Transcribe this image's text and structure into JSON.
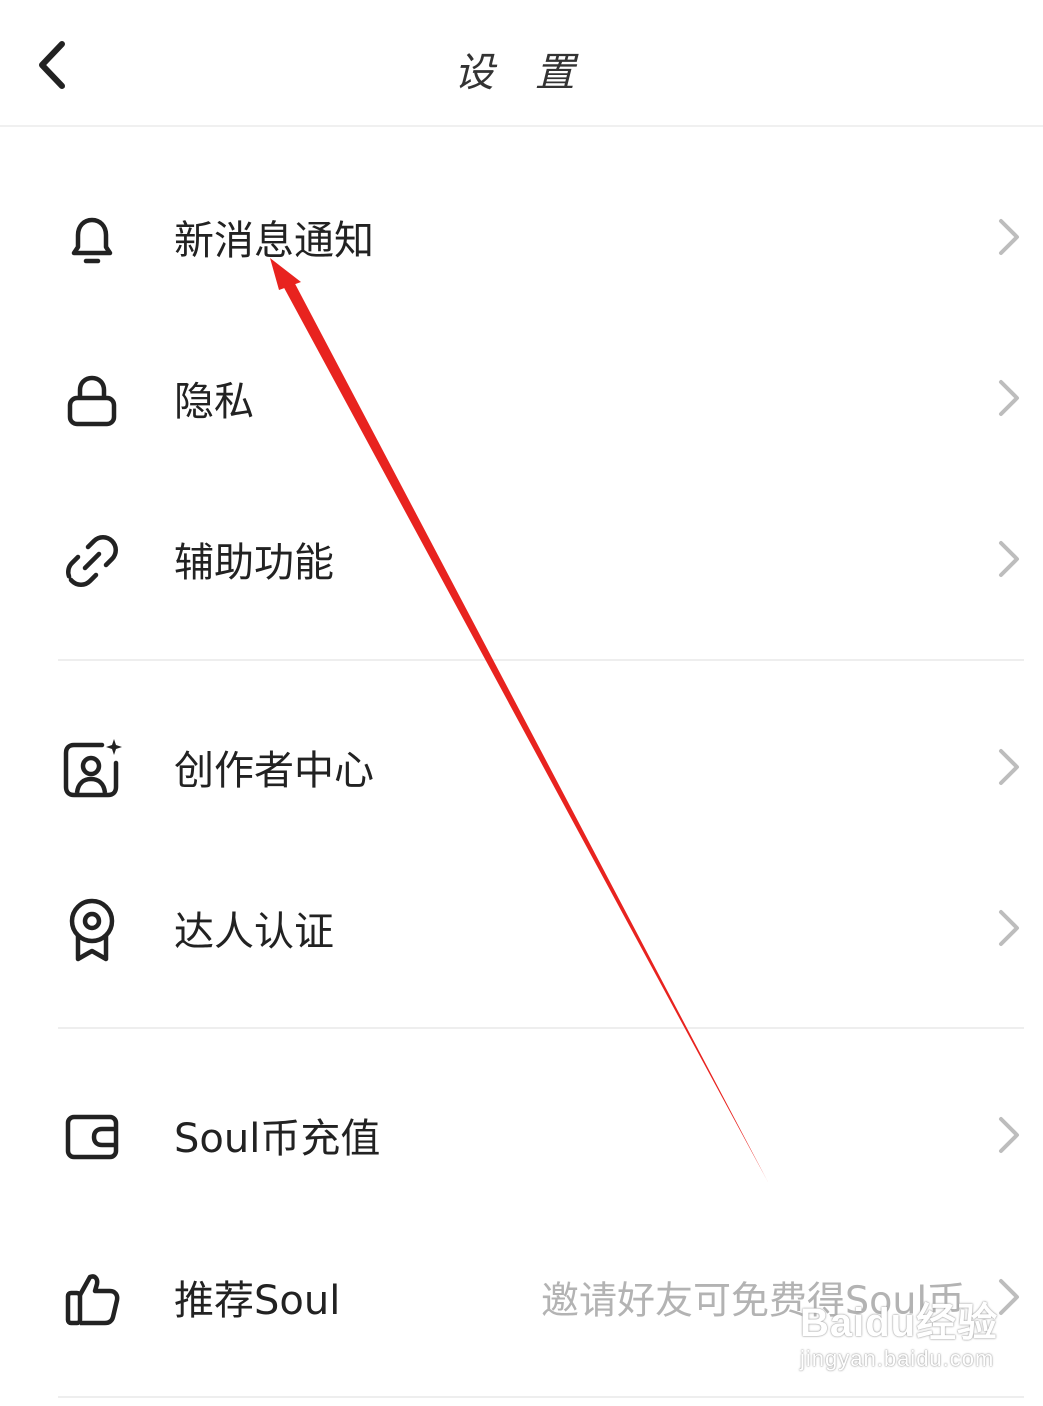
{
  "header": {
    "title": "设 置",
    "back_icon": "chevron-left-icon"
  },
  "menu": {
    "items": [
      {
        "label": "新消息通知",
        "icon": "bell-icon"
      },
      {
        "label": "隐私",
        "icon": "lock-icon"
      },
      {
        "label": "辅助功能",
        "icon": "link-icon"
      },
      {
        "label": "创作者中心",
        "icon": "creator-portrait-icon"
      },
      {
        "label": "达人认证",
        "icon": "badge-award-icon"
      },
      {
        "label": "Soul币充值",
        "icon": "wallet-icon"
      },
      {
        "label": "推荐Soul",
        "icon": "thumbs-up-icon",
        "hint": "邀请好友可免费得Soul币"
      }
    ]
  },
  "watermark": {
    "main": "Baidu经验",
    "sub": "jingyan.baidu.com"
  },
  "colors": {
    "text": "#222222",
    "hint": "#b3b3b3",
    "divider": "#eeeeee",
    "annotation_arrow": "#e8231f"
  }
}
